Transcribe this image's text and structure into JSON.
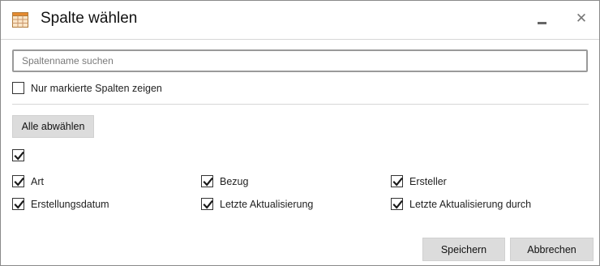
{
  "dialog": {
    "title": "Spalte wählen",
    "title_icon": "table-icon",
    "minimize_icon": "minimize-icon",
    "close_icon": "close-icon",
    "close_glyph": "✕"
  },
  "search": {
    "value": "",
    "placeholder": "Spaltenname suchen"
  },
  "filter": {
    "label": "Nur markierte Spalten zeigen",
    "checked": false
  },
  "deselect_all_label": "Alle abwählen",
  "select_all": {
    "checked": true
  },
  "columns": [
    {
      "label": "Art",
      "checked": true
    },
    {
      "label": "Bezug",
      "checked": true
    },
    {
      "label": "Ersteller",
      "checked": true
    },
    {
      "label": "Erstellungsdatum",
      "checked": true
    },
    {
      "label": "Letzte Aktualisierung",
      "checked": true
    },
    {
      "label": "Letzte Aktualisierung durch",
      "checked": true
    }
  ],
  "footer": {
    "save_label": "Speichern",
    "cancel_label": "Abbrechen"
  }
}
